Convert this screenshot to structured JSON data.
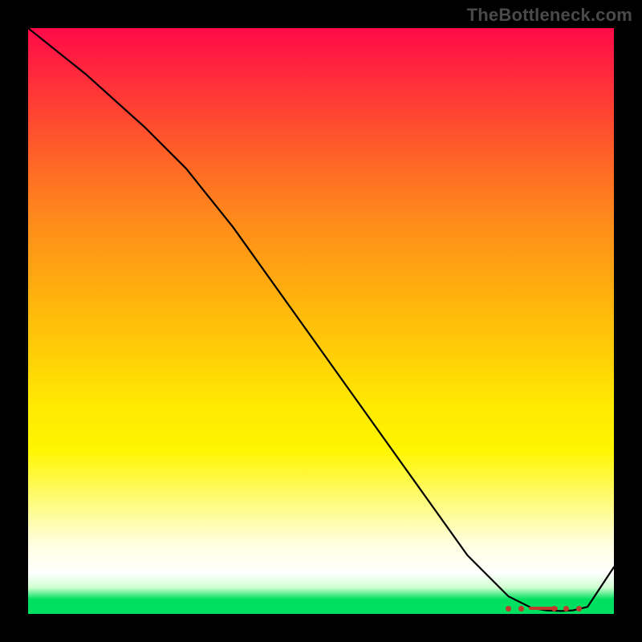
{
  "watermark": "TheBottleneck.com",
  "chart_data": {
    "type": "line",
    "title": "",
    "xlabel": "",
    "ylabel": "",
    "xlim": [
      0,
      100
    ],
    "ylim": [
      0,
      100
    ],
    "series": [
      {
        "name": "curve",
        "x": [
          0,
          10,
          20,
          27,
          35,
          45,
          55,
          65,
          75,
          82,
          86,
          88.5,
          91,
          93,
          95.5,
          100
        ],
        "y": [
          100,
          92,
          83,
          76,
          66,
          52,
          38,
          24,
          10,
          3,
          1,
          0.6,
          0.5,
          0.6,
          1.2,
          8
        ]
      }
    ],
    "valley_marker": {
      "x_start": 82,
      "x_end": 94,
      "y": 0.9
    },
    "gradient_stops": [
      {
        "pos": 0,
        "color": "#ff0a49"
      },
      {
        "pos": 50,
        "color": "#ffd006"
      },
      {
        "pos": 90,
        "color": "#ffffdf"
      },
      {
        "pos": 97,
        "color": "#00e060"
      },
      {
        "pos": 100,
        "color": "#00e060"
      }
    ]
  }
}
